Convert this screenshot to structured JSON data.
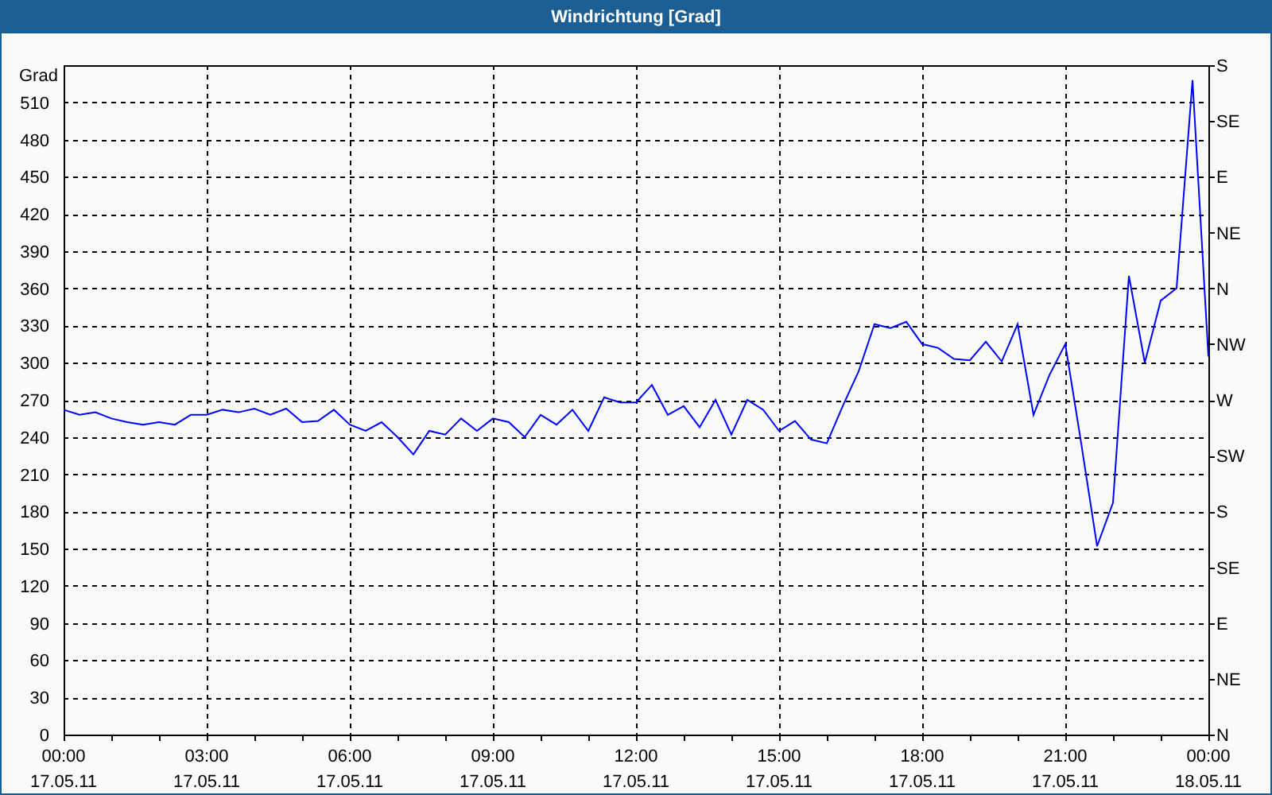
{
  "window": {
    "title": "Windrichtung [Grad]"
  },
  "chart": {
    "chart_data": {
      "type": "line",
      "grid": true,
      "ylabel": "Grad",
      "ylim": [
        0,
        540
      ],
      "yticks": [
        0,
        30,
        60,
        90,
        120,
        150,
        180,
        210,
        240,
        270,
        300,
        330,
        360,
        390,
        420,
        450,
        480,
        510
      ],
      "categories": [
        "00:00 17.05.11",
        null,
        null,
        null,
        null,
        null,
        null,
        null,
        null,
        "03:00 17.05.11",
        null,
        null,
        null,
        null,
        null,
        null,
        null,
        null,
        "06:00 17.05.11",
        null,
        null,
        null,
        null,
        null,
        null,
        null,
        null,
        "09:00 17.05.11",
        null,
        null,
        null,
        null,
        null,
        null,
        null,
        null,
        "12:00 17.05.11",
        null,
        null,
        null,
        null,
        null,
        null,
        null,
        null,
        "15:00 17.05.11",
        null,
        null,
        null,
        null,
        null,
        null,
        null,
        null,
        "18:00 17.05.11",
        null,
        null,
        null,
        null,
        null,
        null,
        null,
        null,
        "21:00 17.05.11",
        null,
        null,
        null,
        null,
        null,
        null,
        null,
        null,
        "00:00 18.05.11"
      ],
      "series": [
        {
          "color": "#0000ff",
          "values": [
            262,
            258,
            260,
            255,
            252,
            250,
            252,
            250,
            258,
            258,
            262,
            260,
            263,
            258,
            263,
            252,
            253,
            262,
            250,
            245,
            252,
            240,
            226,
            245,
            242,
            255,
            245,
            255,
            252,
            240,
            258,
            250,
            262,
            245,
            272,
            268,
            268,
            282,
            258,
            265,
            248,
            270,
            242,
            270,
            262,
            245,
            253,
            238,
            235,
            265,
            293,
            331,
            328,
            333,
            315,
            312,
            303,
            302,
            317,
            301,
            331,
            258,
            290,
            315,
            235,
            152,
            187,
            370,
            300,
            350,
            360,
            528,
            305
          ]
        }
      ]
    },
    "right_axis": [
      "S",
      "SE",
      "E",
      "NE",
      "N",
      "NW",
      "W",
      "SW",
      "S",
      "SE",
      "E",
      "NE",
      "N"
    ]
  }
}
